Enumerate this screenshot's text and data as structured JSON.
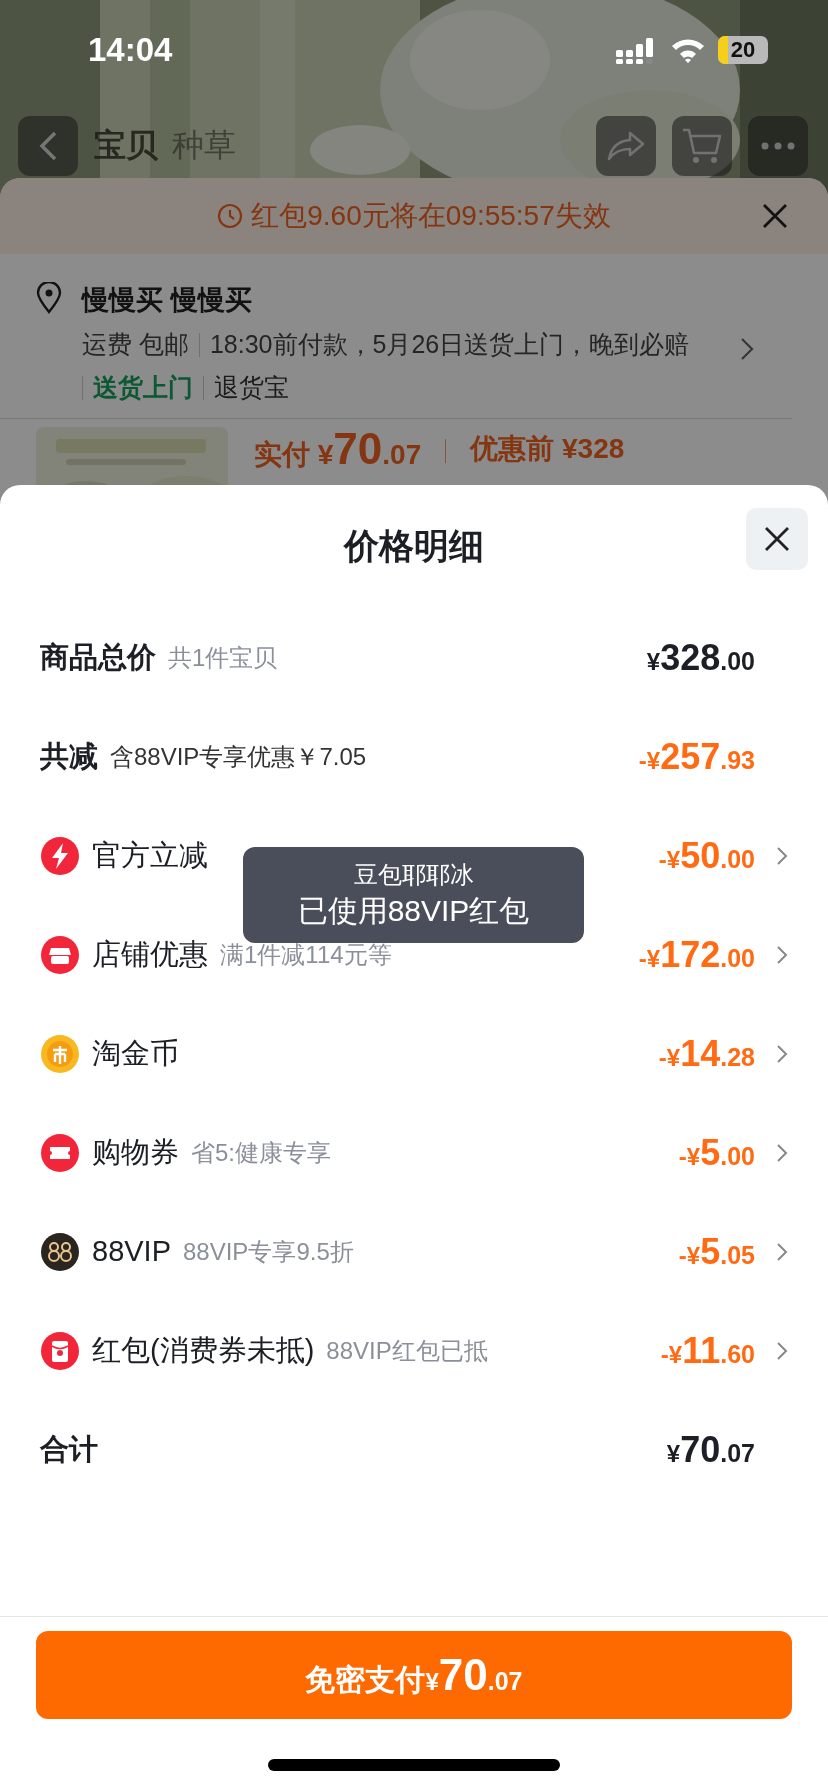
{
  "status_bar": {
    "time": "14:04",
    "battery": "20"
  },
  "nav": {
    "tabs": [
      {
        "label": "宝贝",
        "selected": true
      },
      {
        "label": "种草",
        "selected": false
      }
    ]
  },
  "back_sheet": {
    "countdown": "红包9.60元将在09:55:57失效",
    "address": {
      "name": "慢慢买 慢慢买",
      "shipping": "运费 包邮",
      "delivery": "18:30前付款，5月26日送货上门，晚到必赔",
      "tags": [
        {
          "label": "送货上门",
          "highlighted": true
        },
        {
          "label": "退货宝",
          "highlighted": false
        }
      ]
    },
    "price": {
      "label": "实付",
      "amount": "¥70.07",
      "before": "优惠前 ¥328"
    }
  },
  "modal": {
    "title": "价格明细",
    "rows": [
      {
        "kind": "total_price",
        "label": "商品总价",
        "note": "共1件宝贝",
        "amount": "¥328.00"
      },
      {
        "kind": "discount_sum",
        "label": "共减",
        "note": "含88VIP专享优惠￥7.05",
        "amount": "-¥257.93"
      },
      {
        "kind": "lightning",
        "label": "官方立减",
        "amount": "-¥50.00"
      },
      {
        "kind": "shop",
        "label": "店铺优惠",
        "note": "满1件减114元等",
        "amount": "-¥172.00"
      },
      {
        "kind": "coin",
        "label": "淘金币",
        "amount": "-¥14.28"
      },
      {
        "kind": "ticket",
        "label": "购物券",
        "note": "省5:健康专享",
        "amount": "-¥5.00"
      },
      {
        "kind": "vip",
        "label": "88VIP",
        "note": "88VIP专享9.5折",
        "amount": "-¥5.05"
      },
      {
        "kind": "envelope",
        "label": "红包(消费券未抵)",
        "note": "88VIP红包已抵",
        "amount": "-¥11.60"
      },
      {
        "kind": "sum",
        "label": "合计",
        "amount": "¥70.07"
      }
    ],
    "toast": {
      "lines": [
        "豆包耶耶冰",
        "已使用88VIP红包"
      ]
    },
    "pay_button": {
      "label": "免密支付",
      "amount": "¥70.07"
    }
  }
}
